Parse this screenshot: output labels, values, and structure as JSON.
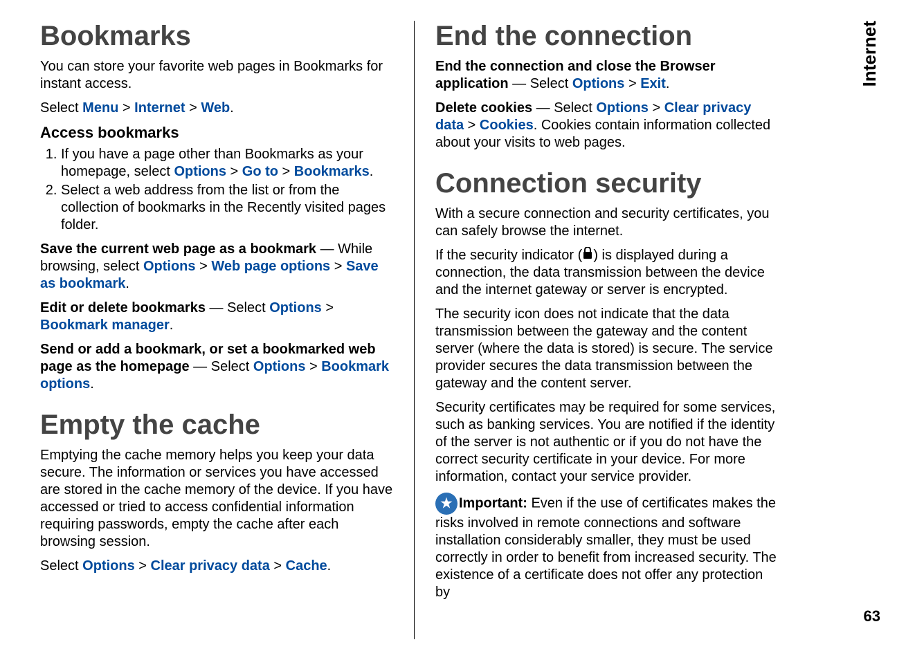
{
  "sideTab": "Internet",
  "pageNumber": "63",
  "left": {
    "h1a": "Bookmarks",
    "p1": "You can store your favorite web pages in Bookmarks for instant access.",
    "p2_pre": "Select ",
    "p2_menu": "Menu",
    "p2_gt1": " > ",
    "p2_internet": "Internet",
    "p2_gt2": " > ",
    "p2_web": "Web",
    "p2_end": ".",
    "h2a": "Access bookmarks",
    "li1_pre": "If you have a page other than Bookmarks as your homepage, select ",
    "li1_opt": "Options",
    "li1_gt1": " > ",
    "li1_goto": "Go to",
    "li1_gt2": " > ",
    "li1_bm": "Bookmarks",
    "li1_end": ".",
    "li2": "Select a web address from the list or from the collection of bookmarks in the Recently visited pages folder.",
    "p3_b": "Save the current web page as a bookmark",
    "p3_dash": " —  While browsing, select ",
    "p3_opt": "Options",
    "p3_gt1": " > ",
    "p3_wpo": "Web page options",
    "p3_gt2": " > ",
    "p3_sab": "Save as bookmark",
    "p3_end": ".",
    "p4_b": "Edit or delete bookmarks",
    "p4_dash": " —  Select ",
    "p4_opt": "Options",
    "p4_gt": " > ",
    "p4_bmm": "Bookmark manager",
    "p4_end": ".",
    "p5_b": "Send or add a bookmark, or set a bookmarked web page as the homepage",
    "p5_dash": " —  Select ",
    "p5_opt": "Options",
    "p5_gt": " > ",
    "p5_bo": "Bookmark options",
    "p5_end": ".",
    "h1b": "Empty the cache",
    "p6": "Emptying the cache memory helps you keep your data secure. The information or services you have accessed are stored in the cache memory of the device. If you have accessed or tried to access confidential information requiring passwords, empty the cache after each browsing session.",
    "p7_pre": "Select ",
    "p7_opt": "Options",
    "p7_gt1": " > ",
    "p7_cpd": "Clear privacy data",
    "p7_gt2": " > ",
    "p7_cache": "Cache",
    "p7_end": "."
  },
  "right": {
    "h1a": "End the connection",
    "p1_b": "End the connection and close the Browser application",
    "p1_dash": " —  Select ",
    "p1_opt": "Options",
    "p1_gt": " > ",
    "p1_exit": "Exit",
    "p1_end": ".",
    "p2_b": "Delete cookies",
    "p2_dash": " —  Select ",
    "p2_opt": "Options",
    "p2_gt1": " > ",
    "p2_cpd": "Clear privacy data",
    "p2_gt2": " > ",
    "p2_cook": "Cookies",
    "p2_end": ". Cookies contain information collected about your visits to web pages.",
    "h1b": "Connection security",
    "p3": "With a secure connection and security certificates, you can safely browse the internet.",
    "p4_pre": "If the security indicator (",
    "p4_post": ") is displayed during a connection, the data transmission between the device and the internet gateway or server is encrypted.",
    "p5": "The security icon does not indicate that the data transmission between the gateway and the content server (where the data is stored) is secure. The service provider secures the data transmission between the gateway and the content server.",
    "p6": "Security certificates may be required for some services, such as banking services. You are notified if the identity of the server is not authentic or if you do not have the correct security certificate in your device. For more information, contact your service provider.",
    "p7_b": "Important:",
    "p7_rest": "  Even if the use of certificates makes the risks involved in remote connections and software installation considerably smaller, they must be used correctly in order to benefit from increased security. The existence of a certificate does not offer any protection by"
  }
}
